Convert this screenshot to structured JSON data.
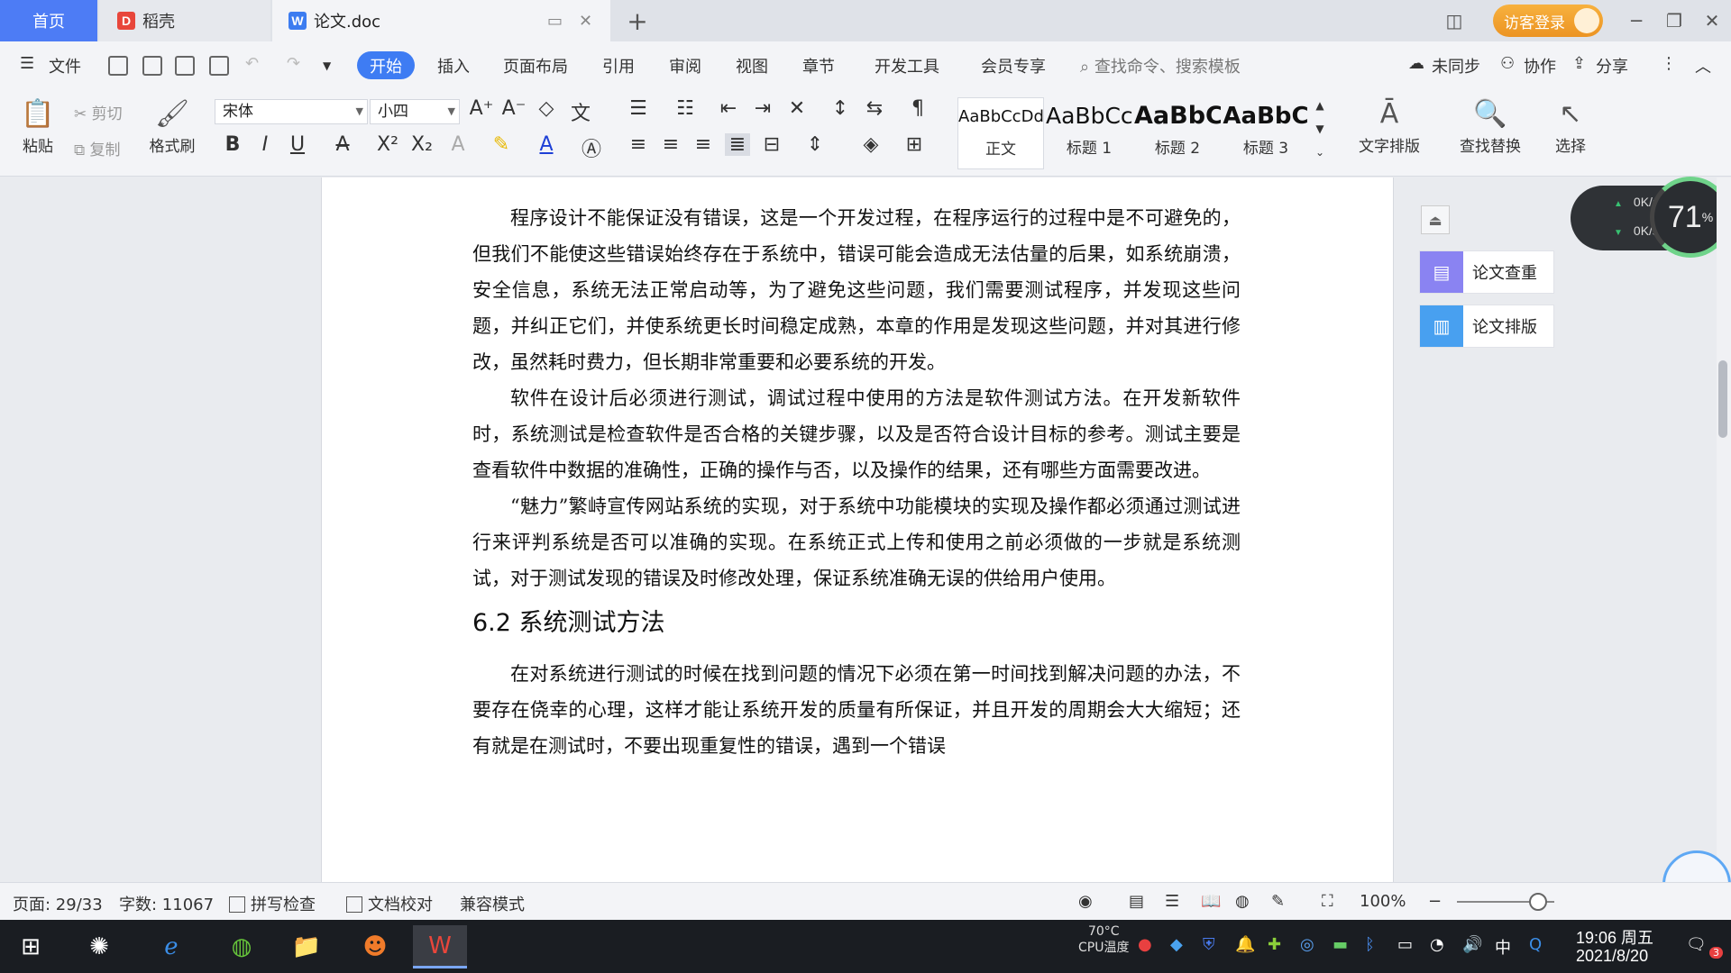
{
  "tabs": {
    "home": "首页",
    "daoke": "稻壳",
    "doc": "论文.doc",
    "visitor_login": "访客登录"
  },
  "menu": {
    "file": "文件",
    "start": "开始",
    "insert": "插入",
    "layout": "页面布局",
    "reference": "引用",
    "review": "审阅",
    "view": "视图",
    "chapter": "章节",
    "devtools": "开发工具",
    "vip": "会员专享",
    "search": "查找命令、搜索模板",
    "unsynced": "未同步",
    "collab": "协作",
    "share": "分享"
  },
  "ribbon": {
    "paste": "粘贴",
    "cut": "剪切",
    "copy": "复制",
    "format_painter": "格式刷",
    "font_name": "宋体",
    "font_size": "小四",
    "styles": [
      {
        "sample": "AaBbCcDd",
        "label": "正文"
      },
      {
        "sample": "AaBbCc",
        "label": "标题 1"
      },
      {
        "sample": "AaBbC",
        "label": "标题 2"
      },
      {
        "sample": "AaBbC",
        "label": "标题 3"
      }
    ],
    "text_layout": "文字排版",
    "find_replace": "查找替换",
    "select": "选择"
  },
  "document": {
    "paragraphs": [
      "程序设计不能保证没有错误，这是一个开发过程，在程序运行的过程中是不可避免的，但我们不能使这些错误始终存在于系统中，错误可能会造成无法估量的后果，如系统崩溃，安全信息，系统无法正常启动等，为了避免这些问题，我们需要测试程序，并发现这些问题，并纠正它们，并使系统更长时间稳定成熟，本章的作用是发现这些问题，并对其进行修改，虽然耗时费力，但长期非常重要和必要系统的开发。",
      "软件在设计后必须进行测试，调试过程中使用的方法是软件测试方法。在开发新软件时，系统测试是检查软件是否合格的关键步骤，以及是否符合设计目标的参考。测试主要是查看软件中数据的准确性，正确的操作与否，以及操作的结果，还有哪些方面需要改进。",
      "“魅力”繁峙宣传网站系统的实现，对于系统中功能模块的实现及操作都必须通过测试进行来评判系统是否可以准确的实现。在系统正式上传和使用之前必须做的一步就是系统测试，对于测试发现的错误及时修改处理，保证系统准确无误的供给用户使用。"
    ],
    "heading": "6.2 系统测试方法",
    "paragraph_after": "在对系统进行测试的时候在找到问题的情况下必须在第一时间找到解决问题的办法，不要存在侥幸的心理，这样才能让系统开发的质量有所保证，并且开发的周期会大大缩短；还有就是在测试时，不要出现重复性的错误，遇到一个错误"
  },
  "side_panel": {
    "check": "论文查重",
    "layout": "论文排版"
  },
  "net_meter": {
    "up": "0K/s",
    "down": "0K/s",
    "cpu_percent": "71",
    "cpu_unit": "%"
  },
  "status": {
    "page": "页面: 29/33",
    "words": "字数: 11067",
    "spell": "拼写检查",
    "proof": "文档校对",
    "compat": "兼容模式",
    "zoom": "100%",
    "zoom_fraction": 0.83
  },
  "taskbar": {
    "cpu_temp": "70°C",
    "cpu_label": "CPU温度",
    "ime": "中",
    "time": "19:06 周五",
    "date": "2021/8/20",
    "notifications": "3"
  },
  "colors": {
    "accent": "#3e7cf3",
    "visitor": "#ec9423"
  }
}
